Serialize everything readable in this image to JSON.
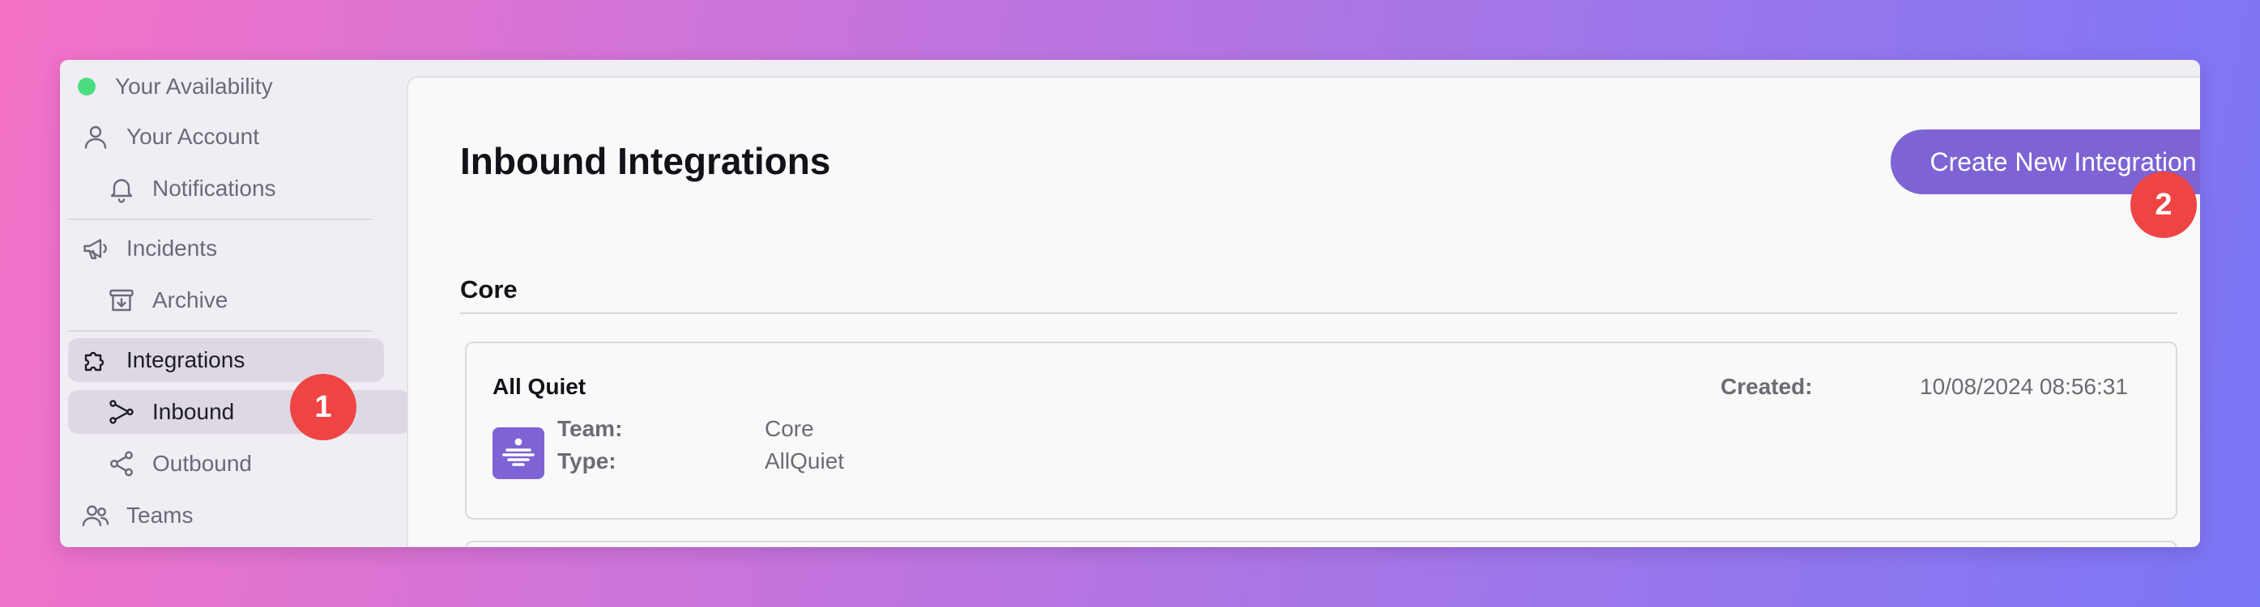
{
  "sidebar": {
    "availability": "Your Availability",
    "items": [
      {
        "label": "Your Account",
        "icon": "user-icon"
      },
      {
        "label": "Notifications",
        "icon": "bell-icon"
      },
      {
        "label": "Incidents",
        "icon": "megaphone-icon"
      },
      {
        "label": "Archive",
        "icon": "archive-icon"
      },
      {
        "label": "Integrations",
        "icon": "puzzle-icon"
      },
      {
        "label": "Inbound",
        "icon": "inbound-branch-icon"
      },
      {
        "label": "Outbound",
        "icon": "share-icon"
      },
      {
        "label": "Teams",
        "icon": "users-icon"
      }
    ],
    "active_items": [
      "Integrations",
      "Inbound"
    ]
  },
  "badges": {
    "first": "1",
    "second": "2"
  },
  "main": {
    "title": "Inbound Integrations",
    "create_button": "Create New Integration",
    "section": "Core",
    "integrations": [
      {
        "name": "All Quiet",
        "team_label": "Team:",
        "team": "Core",
        "type_label": "Type:",
        "type": "AllQuiet",
        "created_label": "Created:",
        "created": "10/08/2024 08:56:31",
        "logo_icon": "allquiet-logo-icon"
      }
    ]
  },
  "colors": {
    "accent": "#7e63d4",
    "badge": "#ef4444",
    "status_online": "#4ade80",
    "active_nav": "#ddd8e3"
  }
}
